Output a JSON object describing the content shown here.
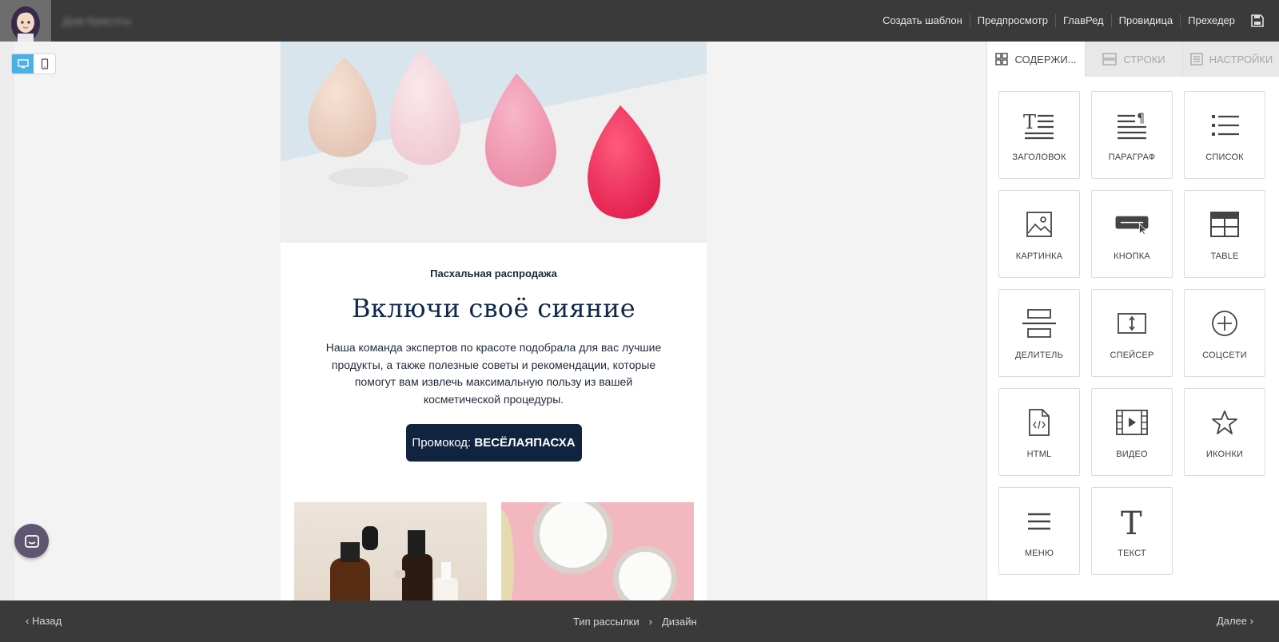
{
  "topbar": {
    "user_name": "Дом Красоты",
    "actions": [
      "Создать шаблон",
      "Предпросмотр",
      "ГлавРед",
      "Провидица",
      "Прехедер"
    ]
  },
  "email": {
    "eyebrow": "Пасхальная распродажа",
    "headline": "Включи своё сияние",
    "body": "Наша команда экспертов по красоте подобрала для вас лучшие продукты, а также полезные советы и рекомендации, которые помогут вам извлечь максимальную пользу из вашей косметической процедуры.",
    "promo_prefix": "Промокод: ",
    "promo_code": "ВЕСЁЛАЯПАСХА"
  },
  "panel": {
    "tabs": [
      "СОДЕРЖИ...",
      "СТРОКИ",
      "НАСТРОЙКИ"
    ],
    "tiles": [
      "ЗАГОЛОВОК",
      "ПАРАГРАФ",
      "СПИСОК",
      "КАРТИНКА",
      "КНОПКА",
      "TABLE",
      "ДЕЛИТЕЛЬ",
      "СПЕЙСЕР",
      "СОЦСЕТИ",
      "HTML",
      "ВИДЕО",
      "ИКОНКИ",
      "МЕНЮ",
      "ТЕКСТ"
    ]
  },
  "bottombar": {
    "back": "Назад",
    "step1": "Тип рассылки",
    "step2": "Дизайн",
    "next": "Далее"
  },
  "colors": {
    "accent": "#4ab0e6",
    "promo_bg": "#10233f",
    "bar_bg": "#3a3a3a"
  }
}
